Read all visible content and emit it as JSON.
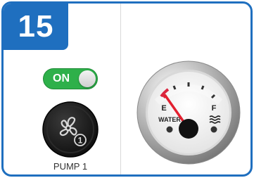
{
  "panel": {
    "number": "15",
    "accent_color": "#1f6fbf"
  },
  "pump": {
    "toggle_label": "ON",
    "toggle_state": "on",
    "toggle_color": "#2eb04a",
    "name": "PUMP 1",
    "icon": "fan-icon",
    "index_badge": "1"
  },
  "gauge": {
    "empty_label": "E",
    "full_label": "F",
    "name": "WATER",
    "level": 0.15,
    "icon": "water-waves-icon"
  }
}
